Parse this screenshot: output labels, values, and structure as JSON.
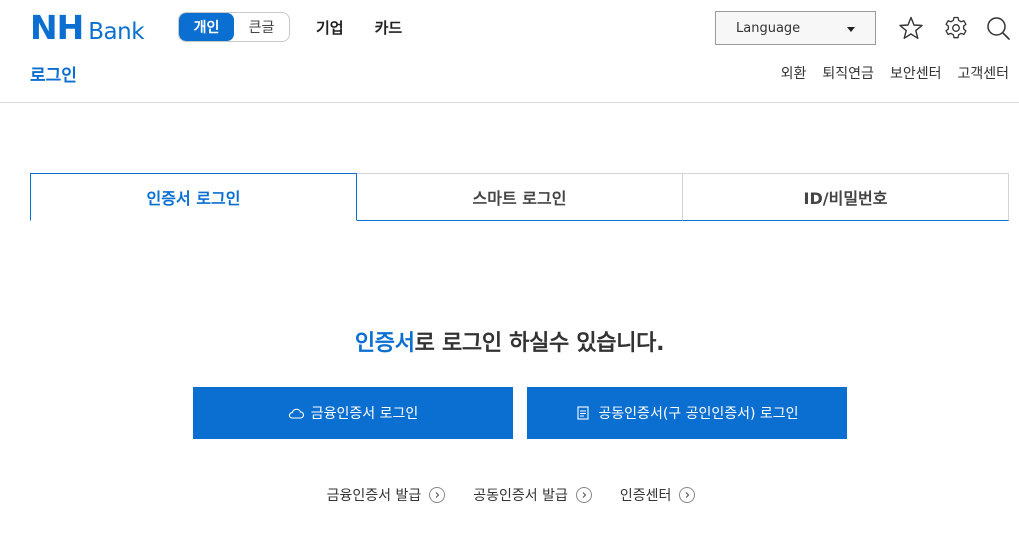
{
  "header": {
    "logo": {
      "nh": "NH",
      "bank": "Bank"
    },
    "segment": [
      {
        "label": "개인",
        "active": true
      },
      {
        "label": "큰글",
        "active": false
      }
    ],
    "nav": [
      "기업",
      "카드"
    ],
    "language": {
      "label": "Language"
    },
    "icons": [
      "star-icon",
      "gear-icon",
      "search-icon"
    ],
    "page_title": "로그인",
    "util_links": [
      "외환",
      "퇴직연금",
      "보안센터",
      "고객센터"
    ]
  },
  "tabs": [
    {
      "label": "인증서 로그인",
      "active": true
    },
    {
      "label": "스마트 로그인",
      "active": false
    },
    {
      "label": "ID/비밀번호",
      "active": false
    }
  ],
  "main": {
    "headline_highlight": "인증서",
    "headline_rest": "로 로그인 하실수 있습니다.",
    "buttons": [
      {
        "label": "금융인증서 로그인",
        "icon": "cloud-icon"
      },
      {
        "label": "공동인증서(구 공인인증서) 로그인",
        "icon": "document-icon"
      }
    ],
    "links": [
      {
        "label": "금융인증서 발급",
        "icon": "chevron-right-circle-icon"
      },
      {
        "label": "공동인증서 발급",
        "icon": "chevron-right-circle-icon"
      },
      {
        "label": "인증센터",
        "icon": "chevron-right-circle-icon"
      }
    ]
  },
  "colors": {
    "brand": "#0a6fd1",
    "text": "#222222",
    "border": "#d4d4d4"
  }
}
